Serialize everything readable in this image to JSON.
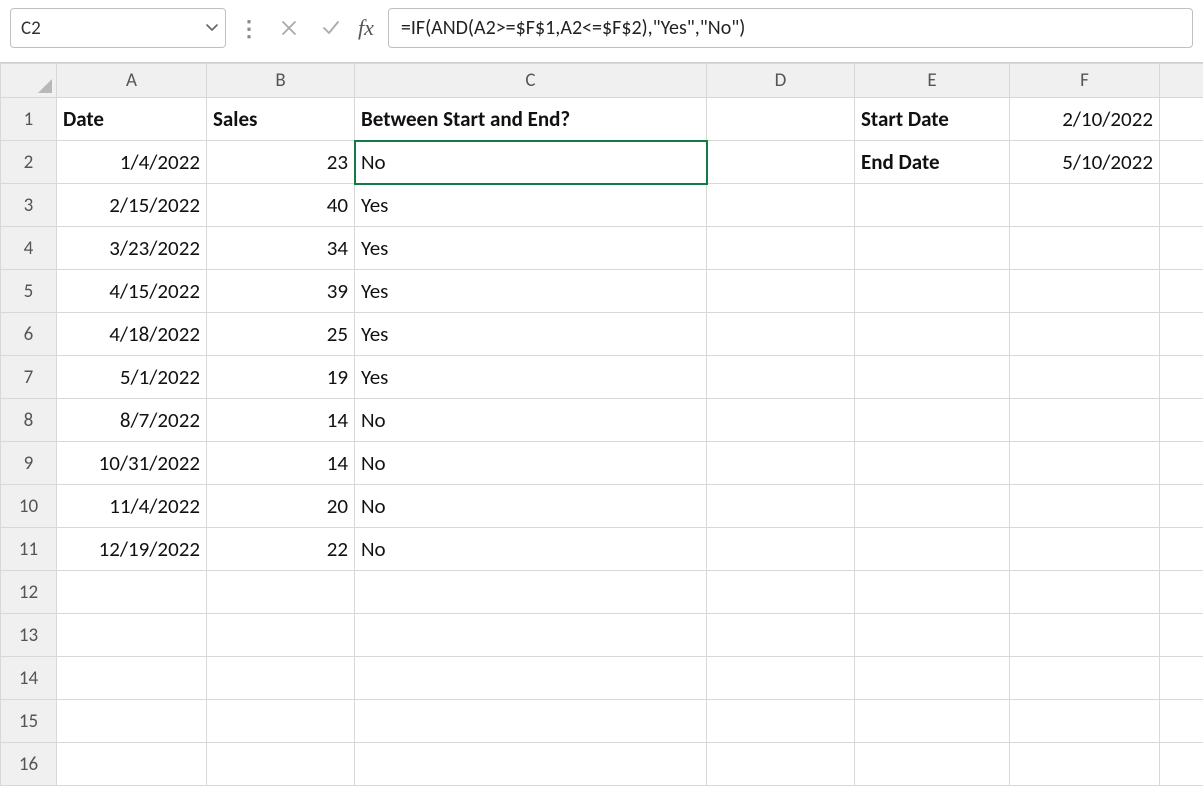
{
  "nameBox": {
    "value": "C2"
  },
  "formulaBar": {
    "formula": "=IF(AND(A2>=$F$1,A2<=$F$2),\"Yes\",\"No\")"
  },
  "columns": [
    "A",
    "B",
    "C",
    "D",
    "E",
    "F"
  ],
  "rowCount": 16,
  "headers": {
    "date": "Date",
    "sales": "Sales",
    "between": "Between Start and End?",
    "startDate": "Start Date",
    "endDate": "End Date"
  },
  "sideValues": {
    "startDateVal": "2/10/2022",
    "endDateVal": "5/10/2022"
  },
  "rows": [
    {
      "date": "1/4/2022",
      "sales": "23",
      "between": "No"
    },
    {
      "date": "2/15/2022",
      "sales": "40",
      "between": "Yes"
    },
    {
      "date": "3/23/2022",
      "sales": "34",
      "between": "Yes"
    },
    {
      "date": "4/15/2022",
      "sales": "39",
      "between": "Yes"
    },
    {
      "date": "4/18/2022",
      "sales": "25",
      "between": "Yes"
    },
    {
      "date": "5/1/2022",
      "sales": "19",
      "between": "Yes"
    },
    {
      "date": "8/7/2022",
      "sales": "14",
      "between": "No"
    },
    {
      "date": "10/31/2022",
      "sales": "14",
      "between": "No"
    },
    {
      "date": "11/4/2022",
      "sales": "20",
      "between": "No"
    },
    {
      "date": "12/19/2022",
      "sales": "22",
      "between": "No"
    }
  ],
  "selectedCell": "C2"
}
